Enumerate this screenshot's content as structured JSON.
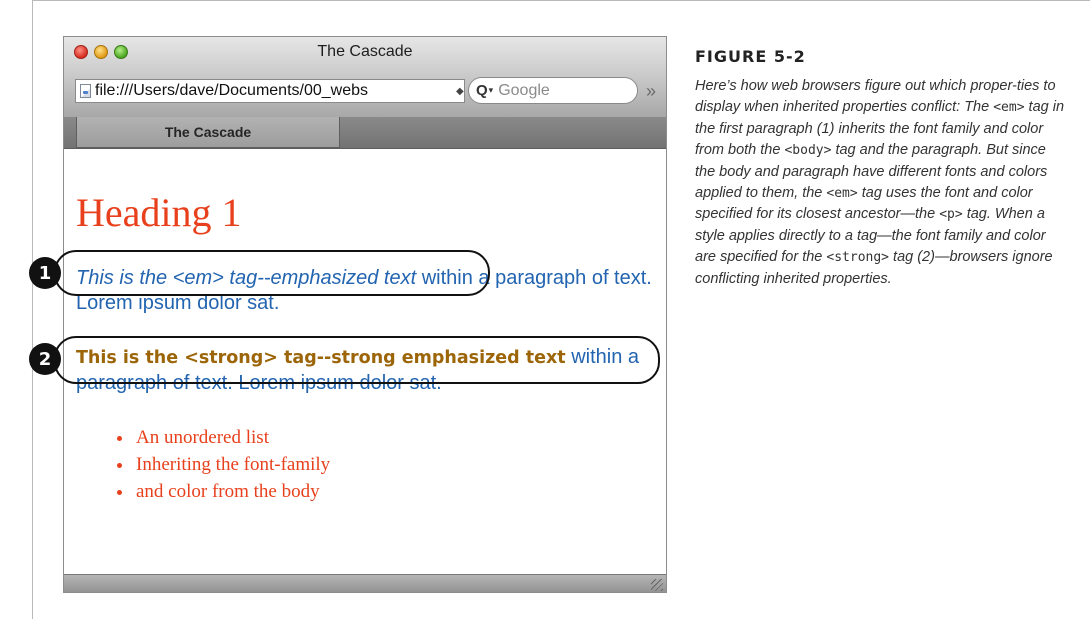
{
  "window": {
    "title": "The Cascade",
    "address": "file:///Users/dave/Documents/00_webs",
    "address_dropdown": "◆",
    "search_placeholder": "Google",
    "overflow": "»",
    "tab_label": "The Cascade"
  },
  "page": {
    "heading": "Heading 1",
    "para1": {
      "em": "This is the <em> tag--emphasized text",
      "rest": " within a paragraph of text. Lorem ipsum dolor sat."
    },
    "para2": {
      "strong": "This is the <strong> tag--strong emphasized text",
      "rest": " within a paragraph of text. Lorem ipsum dolor sat."
    },
    "list": [
      "An unordered list",
      "Inheriting the font-family",
      "and color from the body"
    ]
  },
  "callouts": [
    "1",
    "2"
  ],
  "figure": {
    "label": "FIGURE 5-2",
    "caption": {
      "t1": "Here’s how web browsers figure out which proper-ties to display when inherited properties conflict: The ",
      "c1": "<em>",
      "t2": " tag in the first paragraph (1) inherits the font family and color from both the ",
      "c2": "<body>",
      "t3": " tag and the paragraph. But since the body and paragraph have different fonts and colors applied to them, the ",
      "c3": "<em>",
      "t4": " tag uses the font and color specified for its closest ancestor—the ",
      "c4": "<p>",
      "t5": " tag. When a style applies directly to a tag—the font family and color are specified for the ",
      "c5": "<strong>",
      "t6": " tag (2)—browsers ignore conflicting inherited properties."
    }
  },
  "colors": {
    "heading": "#e8401c",
    "paragraph": "#2264b0",
    "strong": "#9c6508",
    "list": "#e8401c"
  }
}
